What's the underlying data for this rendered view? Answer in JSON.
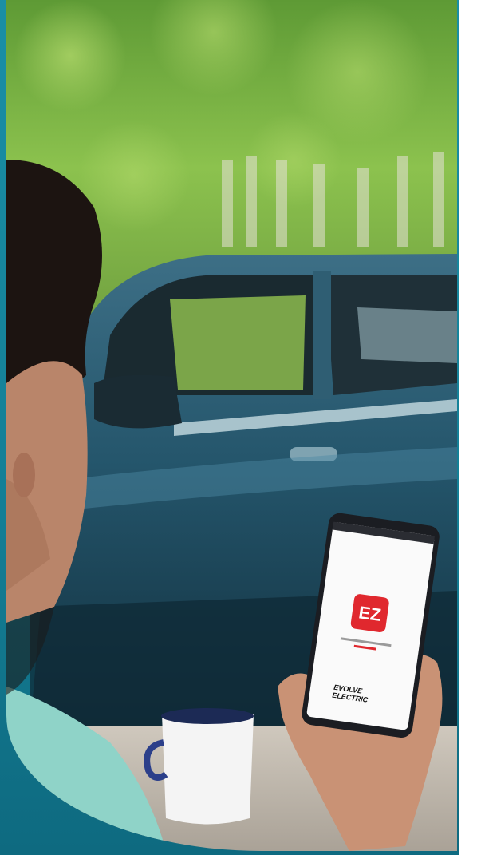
{
  "scene": {
    "subject": "person holding smartphone in front of blue car",
    "colors": {
      "panel_teal": "#1a8fa6",
      "car_blue": "#1d4a5c",
      "foliage_green": "#7fb74a",
      "shirt_teal": "#8fd3c8",
      "app_red": "#e0282e"
    }
  },
  "phone_screen": {
    "logo_text": "EZ",
    "brand_line1": "EVOLVE",
    "brand_line2": "ELECTRIC"
  }
}
